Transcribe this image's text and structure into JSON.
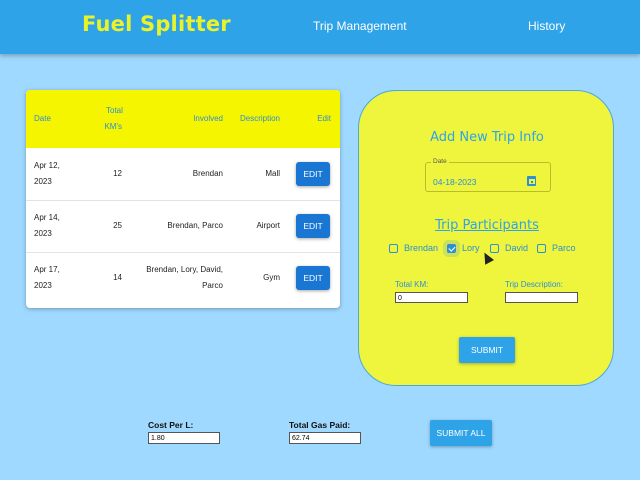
{
  "header": {
    "brand": "Fuel Splitter",
    "nav": [
      "Trip Management",
      "History"
    ],
    "bg_color": "#2ea3e8",
    "brand_color": "#eaf32a"
  },
  "table": {
    "headers": {
      "date": "Date",
      "total_kms_line1": "Total",
      "total_kms_line2": "KM's",
      "involved": "Involved",
      "description": "Description",
      "edit": "Edit"
    },
    "rows": [
      {
        "date_l1": "Apr 12,",
        "date_l2": "2023",
        "kms": "12",
        "involved_l1": "Brendan",
        "involved_l2": "",
        "description": "Mall",
        "edit_label": "EDIT"
      },
      {
        "date_l1": "Apr 14,",
        "date_l2": "2023",
        "kms": "25",
        "involved_l1": "Brendan, Parco",
        "involved_l2": "",
        "description": "Airport",
        "edit_label": "EDIT"
      },
      {
        "date_l1": "Apr 17,",
        "date_l2": "2023",
        "kms": "14",
        "involved_l1": "Brendan, Lory, David,",
        "involved_l2": "Parco",
        "description": "Gym",
        "edit_label": "EDIT"
      }
    ],
    "header_bg": "#f5f500",
    "header_text_color": "#2d8fd6"
  },
  "form": {
    "title": "Add New Trip Info",
    "date_label": "Date",
    "date_value": "04-18-2023",
    "participants_title": "Trip Participants",
    "participants": [
      {
        "name": "Brendan",
        "checked": false
      },
      {
        "name": "Lory",
        "checked": true
      },
      {
        "name": "David",
        "checked": false
      },
      {
        "name": "Parco",
        "checked": false
      }
    ],
    "total_km_label": "Total KM:",
    "total_km_value": "0",
    "description_label": "Trip Description:",
    "description_value": "",
    "submit_label": "SUBMIT",
    "bg_color": "#eef53c"
  },
  "bottom": {
    "cost_label": "Cost Per L:",
    "cost_value": "1.80",
    "gas_label": "Total Gas Paid:",
    "gas_value": "62.74",
    "submit_all_label": "SUBMIT ALL"
  },
  "page_bg": "#9fd9ff",
  "accent": "#2ea3e8"
}
